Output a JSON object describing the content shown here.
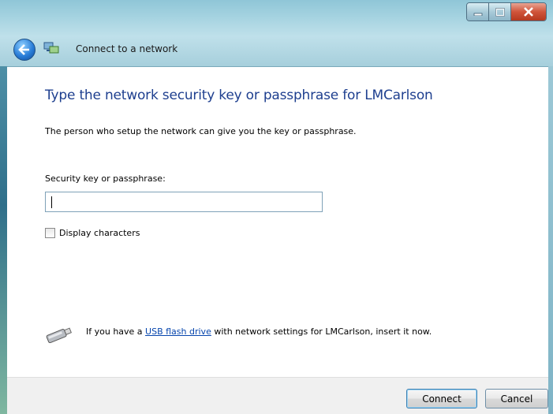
{
  "window": {
    "nav_title": "Connect to a network",
    "controls": {
      "minimize_icon": "minimize-icon",
      "maximize_icon": "maximize-icon",
      "close_icon": "close-icon"
    }
  },
  "main": {
    "heading": "Type the network security key or passphrase for LMCarlson",
    "description": "The person who setup the network can give you the key or passphrase.",
    "field_label": "Security key or passphrase:",
    "field_value": "",
    "checkbox_label": "Display characters",
    "checkbox_checked": false,
    "usb": {
      "prefix": "If you have a ",
      "link_text": "USB flash drive",
      "suffix": " with network settings for LMCarlson, insert it now."
    }
  },
  "footer": {
    "connect_label": "Connect",
    "cancel_label": "Cancel"
  },
  "colors": {
    "heading": "#1e3f8f",
    "link": "#0645ad",
    "close_button": "#d0543a"
  }
}
